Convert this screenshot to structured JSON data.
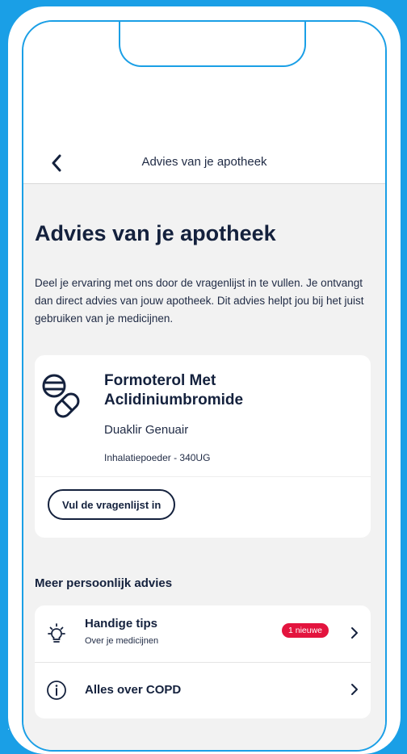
{
  "nav": {
    "title": "Advies van je apotheek"
  },
  "page": {
    "title": "Advies van je apotheek",
    "intro": "Deel je ervaring met ons door de vragenlijst in te vullen. Je ontvangt dan direct advies van jouw apotheek. Dit advies helpt jou bij het juist gebruiken van je medicijnen."
  },
  "medication": {
    "name": "Formoterol Met Aclidiniumbromide",
    "brand": "Duaklir Genuair",
    "form": "Inhalatiepoeder - 340UG",
    "survey_button": "Vul de vragenlijst in",
    "icon": "pills-icon"
  },
  "advice": {
    "section_title": "Meer persoonlijk advies",
    "items": [
      {
        "title": "Handige tips",
        "subtitle": "Over je medicijnen",
        "badge": "1 nieuwe",
        "icon": "lightbulb-icon"
      },
      {
        "title": "Alles over COPD",
        "icon": "info-icon"
      }
    ]
  },
  "colors": {
    "brand_blue": "#1a9fe6",
    "navy": "#14213d",
    "badge_red": "#e3143e",
    "background": "#f2f2f2"
  }
}
